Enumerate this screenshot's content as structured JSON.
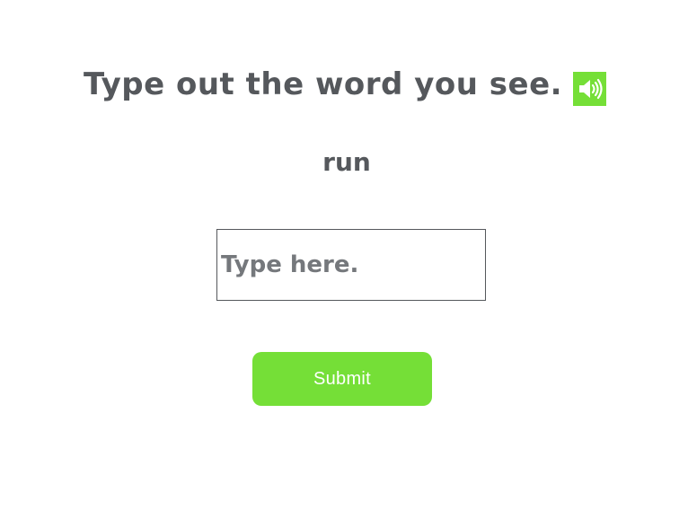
{
  "prompt": {
    "title": "Type out the word you see."
  },
  "audio_button": {
    "icon": "speaker-icon",
    "color": "#75df37"
  },
  "word": {
    "text": "run"
  },
  "answer": {
    "value": "",
    "placeholder": "Type here."
  },
  "submit": {
    "label": "Submit",
    "color": "#75df37"
  },
  "colors": {
    "text": "#55585c",
    "accent": "#75df37"
  }
}
